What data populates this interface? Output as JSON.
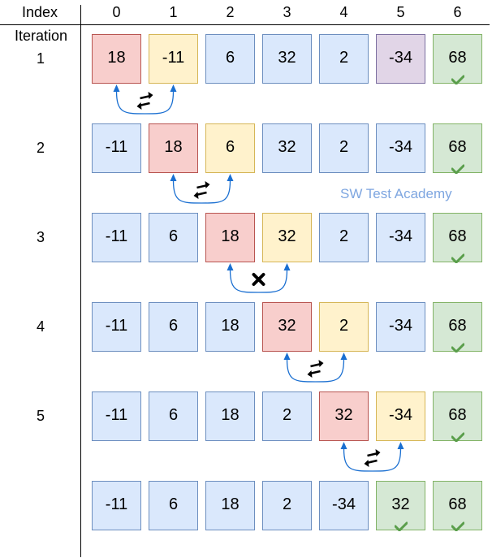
{
  "header": {
    "index_label": "Index",
    "iteration_label": "Iteration",
    "columns": [
      "0",
      "1",
      "2",
      "3",
      "4",
      "5",
      "6"
    ]
  },
  "watermark": "SW Test Academy",
  "colors": {
    "default": "#dae8fc",
    "current": "#f8cecc",
    "compared": "#fff2cc",
    "sorted": "#d5e8d4",
    "highlight": "#e1d5e7",
    "arrow": "#1a6fd1"
  },
  "rows": [
    {
      "label": "1",
      "values": [
        "18",
        "-11",
        "6",
        "32",
        "2",
        "-34",
        "68"
      ],
      "states": [
        "current",
        "compared",
        "default",
        "default",
        "default",
        "highlight",
        "sorted"
      ],
      "action": {
        "from": 0,
        "to": 1,
        "type": "swap",
        "icon": "swap-arrows-icon"
      }
    },
    {
      "label": "2",
      "values": [
        "-11",
        "18",
        "6",
        "32",
        "2",
        "-34",
        "68"
      ],
      "states": [
        "default",
        "current",
        "compared",
        "default",
        "default",
        "default",
        "sorted"
      ],
      "action": {
        "from": 1,
        "to": 2,
        "type": "swap",
        "icon": "swap-arrows-icon"
      }
    },
    {
      "label": "3",
      "values": [
        "-11",
        "6",
        "18",
        "32",
        "2",
        "-34",
        "68"
      ],
      "states": [
        "default",
        "default",
        "current",
        "compared",
        "default",
        "default",
        "sorted"
      ],
      "action": {
        "from": 2,
        "to": 3,
        "type": "no-swap",
        "icon": "no-swap-x-icon"
      }
    },
    {
      "label": "4",
      "values": [
        "-11",
        "6",
        "18",
        "32",
        "2",
        "-34",
        "68"
      ],
      "states": [
        "default",
        "default",
        "default",
        "current",
        "compared",
        "default",
        "sorted"
      ],
      "action": {
        "from": 3,
        "to": 4,
        "type": "swap",
        "icon": "swap-arrows-icon"
      }
    },
    {
      "label": "5",
      "values": [
        "-11",
        "6",
        "18",
        "2",
        "32",
        "-34",
        "68"
      ],
      "states": [
        "default",
        "default",
        "default",
        "default",
        "current",
        "compared",
        "sorted"
      ],
      "action": {
        "from": 4,
        "to": 5,
        "type": "swap",
        "icon": "swap-arrows-icon"
      }
    },
    {
      "label": "",
      "values": [
        "-11",
        "6",
        "18",
        "2",
        "-34",
        "32",
        "68"
      ],
      "states": [
        "default",
        "default",
        "default",
        "default",
        "default",
        "sorted",
        "sorted"
      ],
      "action": null
    }
  ]
}
